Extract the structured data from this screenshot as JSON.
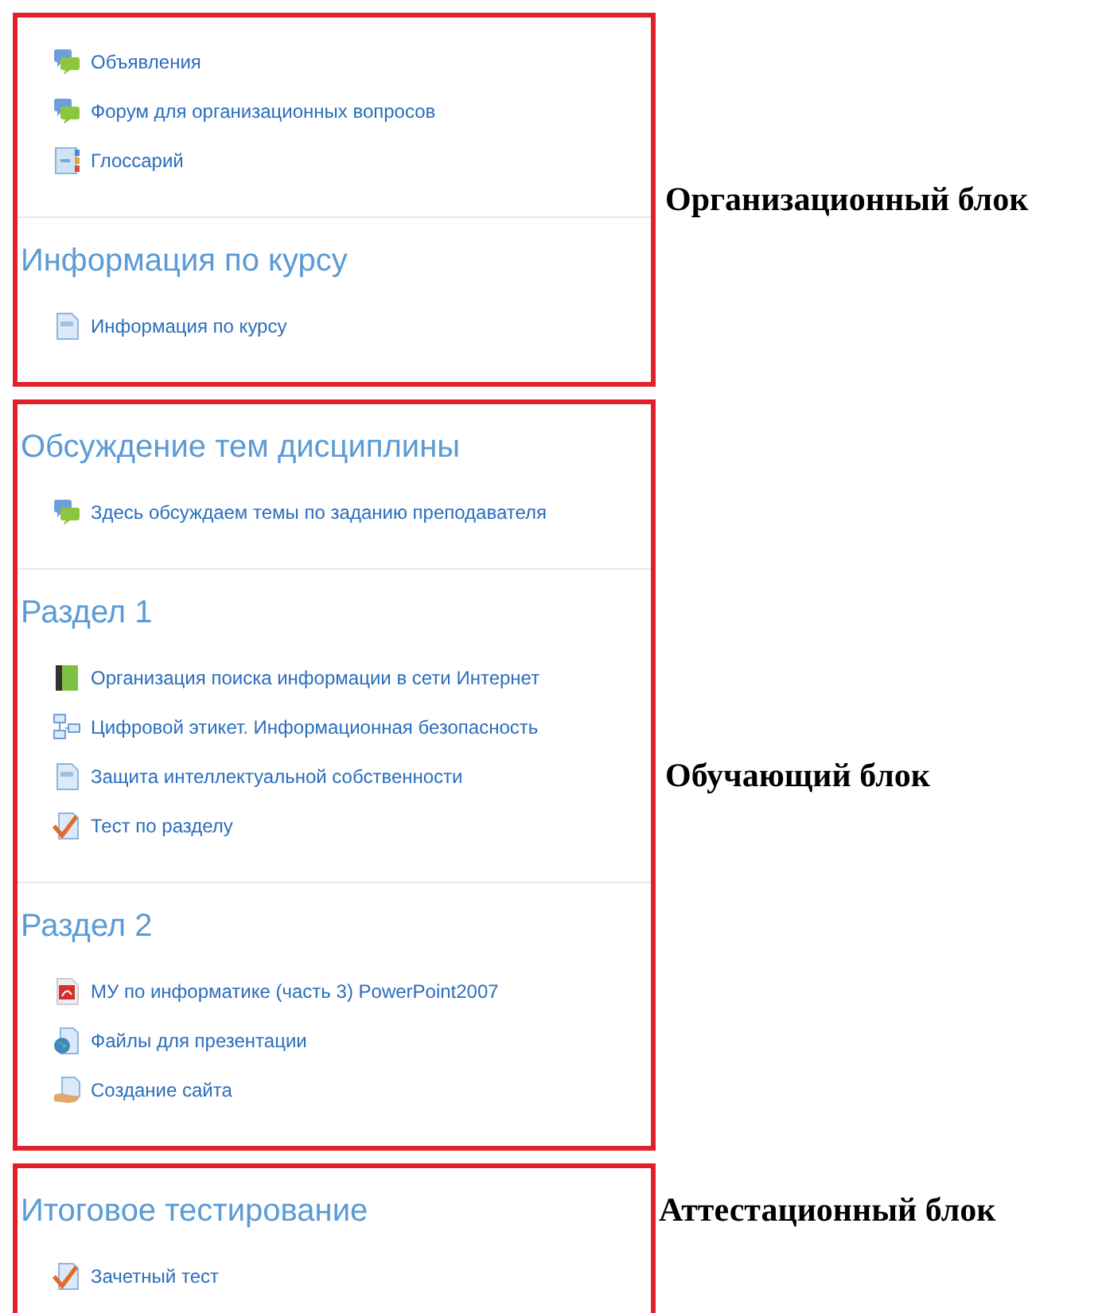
{
  "blocks": [
    {
      "label": "Организационный блок",
      "sections": [
        {
          "items": [
            {
              "kind": "forum",
              "text": "Объявления"
            },
            {
              "kind": "forum",
              "text": "Форум для организационных вопросов"
            },
            {
              "kind": "glossary",
              "text": "Глоссарий"
            }
          ]
        },
        {
          "title": "Информация по курсу",
          "items": [
            {
              "kind": "page",
              "text": "Информация по курсу"
            }
          ]
        }
      ]
    },
    {
      "label": "Обучающий блок",
      "sections": [
        {
          "title": "Обсуждение тем дисциплины",
          "items": [
            {
              "kind": "forum",
              "text": "Здесь обсуждаем темы по заданию преподавателя"
            }
          ]
        },
        {
          "title": "Раздел 1",
          "items": [
            {
              "kind": "book",
              "text": "Организация поиска информации в сети Интернет"
            },
            {
              "kind": "structure",
              "text": "Цифровой этикет. Информационная безопасность"
            },
            {
              "kind": "page",
              "text": "Защита интеллектуальной собственности"
            },
            {
              "kind": "quiz",
              "text": "Тест по разделу"
            }
          ]
        },
        {
          "title": "Раздел 2",
          "items": [
            {
              "kind": "pdf",
              "text": "МУ по информатике (часть 3) PowerPoint2007"
            },
            {
              "kind": "url",
              "text": "Файлы для презентации"
            },
            {
              "kind": "assignment",
              "text": "Создание сайта"
            }
          ]
        }
      ]
    },
    {
      "label": "Аттестационный блок",
      "sections": [
        {
          "title": "Итоговое тестирование",
          "items": [
            {
              "kind": "quiz",
              "text": "Зачетный тест"
            }
          ]
        }
      ]
    }
  ]
}
